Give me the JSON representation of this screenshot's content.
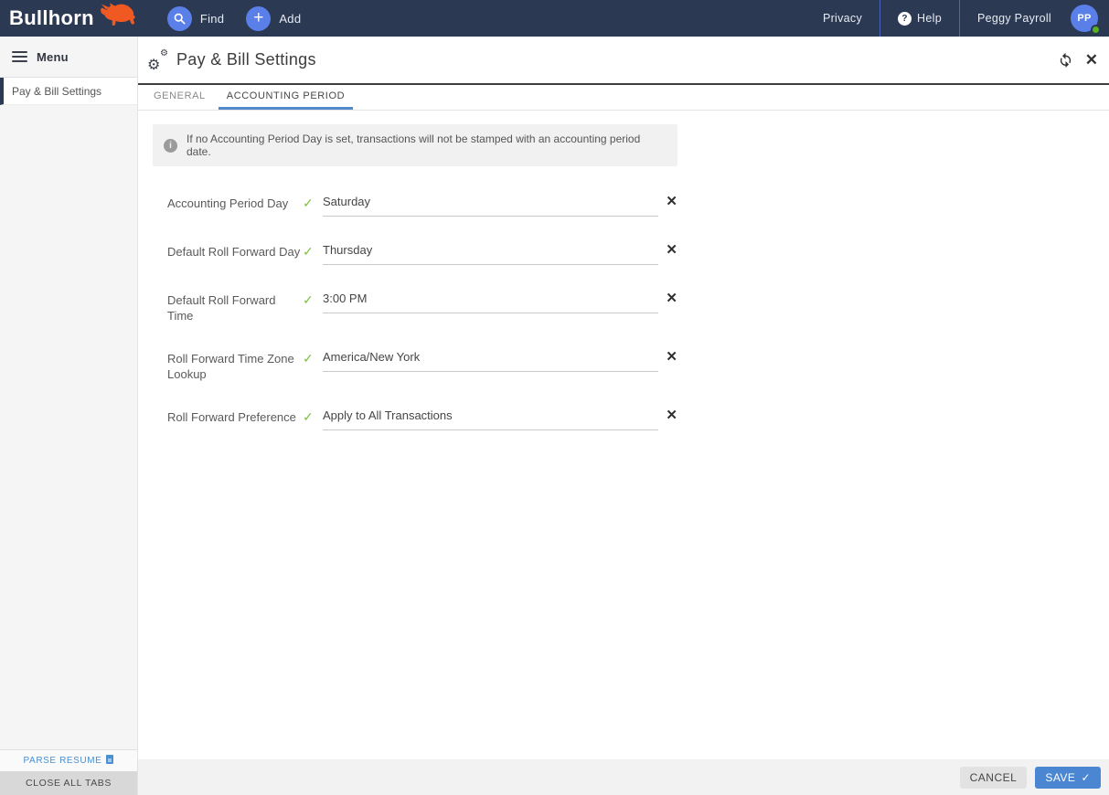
{
  "navbar": {
    "brand": "Bullhorn",
    "find_label": "Find",
    "add_label": "Add",
    "privacy_label": "Privacy",
    "help_label": "Help",
    "user_name": "Peggy Payroll",
    "avatar_initials": "PP"
  },
  "sidebar": {
    "menu_label": "Menu",
    "items": [
      {
        "label": "Pay & Bill Settings"
      }
    ],
    "parse_resume_label": "PARSE RESUME",
    "close_all_tabs_label": "CLOSE ALL TABS"
  },
  "header": {
    "title": "Pay & Bill Settings"
  },
  "tabs": [
    {
      "label": "GENERAL",
      "active": false
    },
    {
      "label": "ACCOUNTING PERIOD",
      "active": true
    }
  ],
  "banner": {
    "text": "If no Accounting Period Day is set, transactions will not be stamped with an accounting period date."
  },
  "form": {
    "fields": [
      {
        "label": "Accounting Period Day",
        "value": "Saturday"
      },
      {
        "label": "Default Roll Forward Day",
        "value": "Thursday"
      },
      {
        "label": "Default Roll Forward Time",
        "value": "3:00 PM"
      },
      {
        "label": "Roll Forward Time Zone Lookup",
        "value": "America/New York"
      },
      {
        "label": "Roll Forward Preference",
        "value": "Apply to All Transactions"
      }
    ]
  },
  "footer": {
    "cancel_label": "CANCEL",
    "save_label": "SAVE"
  },
  "icons": {
    "check": "✓",
    "clear": "✕",
    "close": "✕",
    "plus": "+",
    "question": "?",
    "info": "i",
    "gear": "⚙",
    "save_check": "✓"
  },
  "colors": {
    "navbar_bg": "#2b3953",
    "action_blue": "#5b7fe9",
    "tab_accent": "#5089cc",
    "link_blue": "#4a90d2",
    "save_blue": "#4a86d2",
    "check_green": "#7ec142",
    "status_green": "#57b31b",
    "brand_orange": "#f05a22"
  }
}
